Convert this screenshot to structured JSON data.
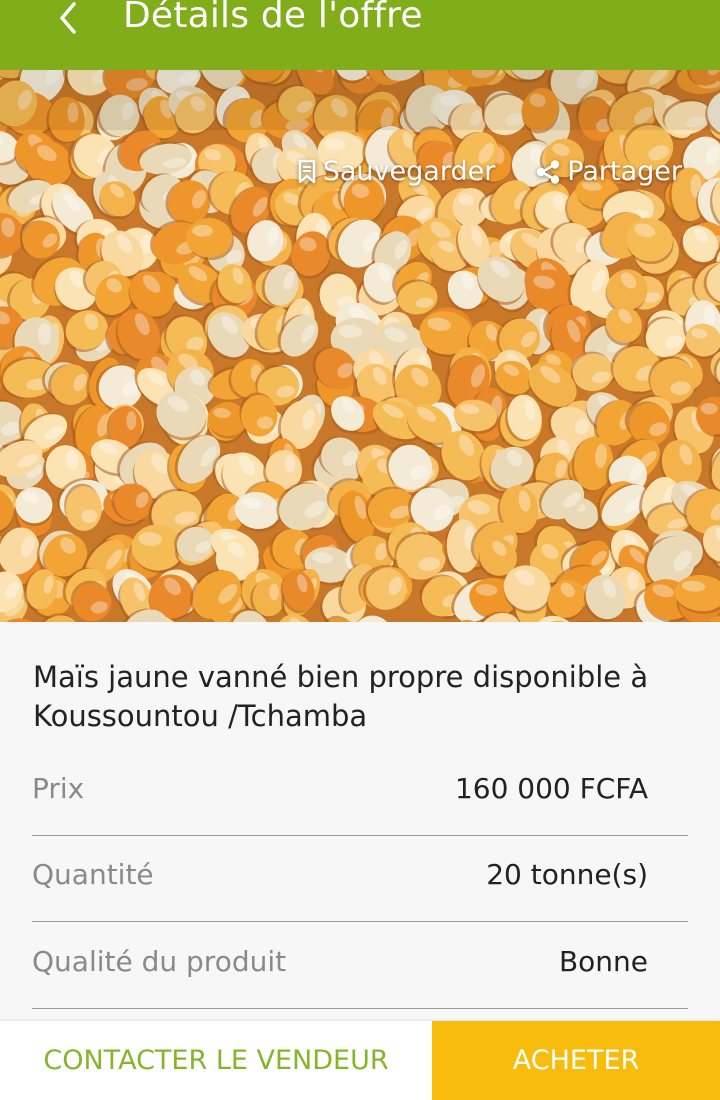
{
  "header": {
    "title": "Détails de l'offre",
    "back_icon": "chevron-left-icon",
    "background": "#80ad19"
  },
  "hero": {
    "image_subject": "yellow maize kernels",
    "save_label": "Sauvegarder",
    "save_icon": "bookmark-icon",
    "share_label": "Partager",
    "share_icon": "share-icon"
  },
  "offer": {
    "title": "Maïs jaune vanné bien propre disponible à Koussountou /Tchamba",
    "details": [
      {
        "label": "Prix",
        "value": "160 000 FCFA"
      },
      {
        "label": "Quantité",
        "value": "20 tonne(s)"
      },
      {
        "label": "Qualité du produit",
        "value": "Bonne"
      }
    ]
  },
  "actions": {
    "contact_label": "CONTACTER LE VENDEUR",
    "buy_label": "ACHETER",
    "contact_color": "#86b52a",
    "buy_color": "#f7bc0c"
  }
}
